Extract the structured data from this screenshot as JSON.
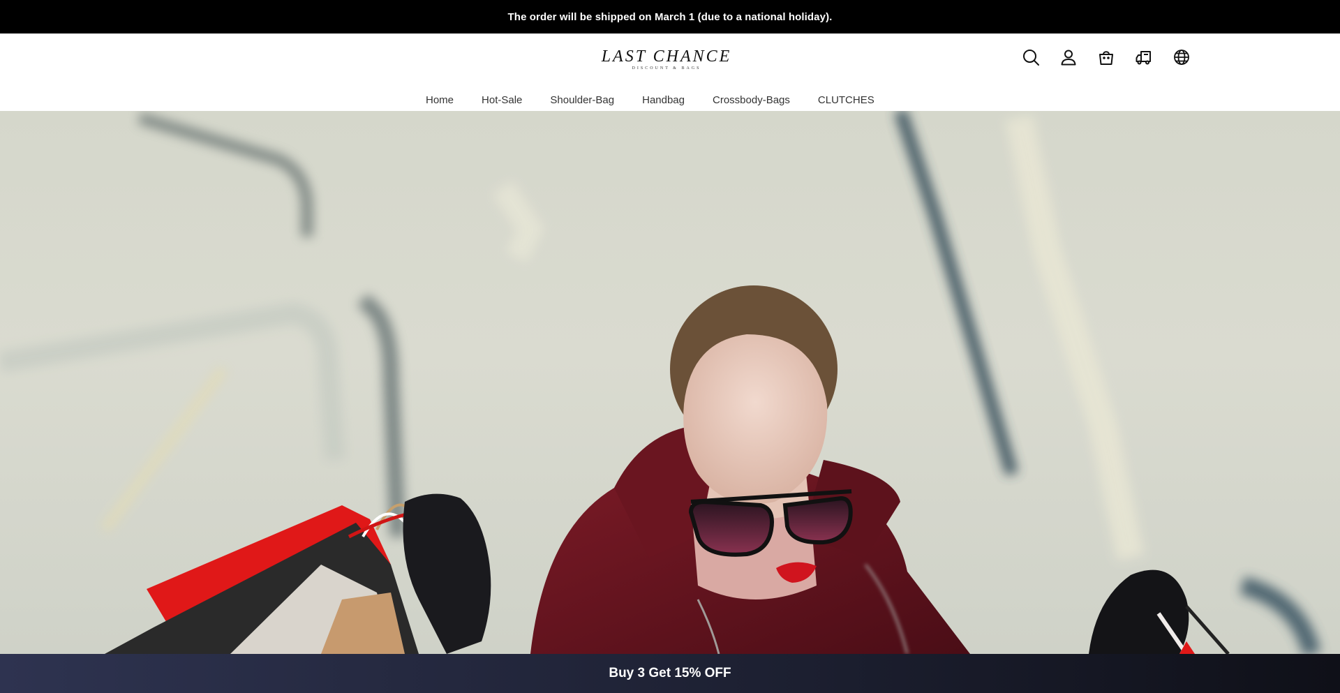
{
  "announcement": {
    "text": "The order will be shipped on March 1 (due to a national holiday)."
  },
  "brand": {
    "name": "LAST CHANCE",
    "tagline": "DISCOUNT & BAGS"
  },
  "header_icons": [
    {
      "name": "search-icon"
    },
    {
      "name": "account-icon"
    },
    {
      "name": "cart-icon"
    },
    {
      "name": "order-tracking-icon"
    },
    {
      "name": "language-globe-icon"
    }
  ],
  "nav": {
    "items": [
      {
        "label": "Home"
      },
      {
        "label": "Hot-Sale"
      },
      {
        "label": "Shoulder-Bag"
      },
      {
        "label": "Handbag"
      },
      {
        "label": "Crossbody-Bags"
      },
      {
        "label": "CLUTCHES"
      }
    ]
  },
  "hero": {
    "image": "woman-with-shopping-bags-photo"
  },
  "promo": {
    "text": "Buy 3 Get 15% OFF"
  },
  "colors": {
    "announcement_bg": "#000000",
    "promo_bg": "#1c1f30",
    "accent_red": "#e01818"
  }
}
